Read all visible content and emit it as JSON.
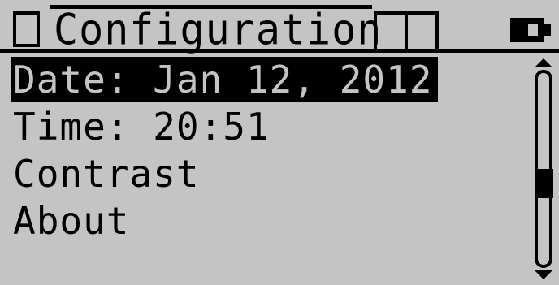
{
  "header": {
    "title": "Configuration",
    "left_icon": "frame-icon",
    "mid_icon": "panels-icon",
    "battery_icon": "battery-icon"
  },
  "menu": {
    "items": [
      {
        "label": "Date: Jan 12, 2012",
        "selected": true
      },
      {
        "label": "Time: 20:51",
        "selected": false
      },
      {
        "label": "Contrast",
        "selected": false
      },
      {
        "label": "About",
        "selected": false
      }
    ]
  },
  "scrollbar": {
    "up_icon": "arrow-up-icon",
    "down_icon": "arrow-down-icon"
  },
  "colors": {
    "background": "#c4c4c4",
    "foreground": "#000000"
  }
}
